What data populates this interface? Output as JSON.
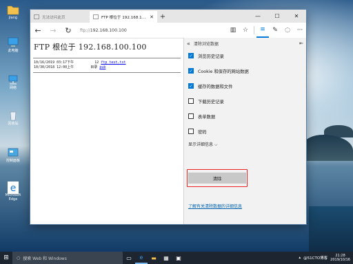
{
  "desktop": {
    "icons": [
      {
        "label": "jiang"
      },
      {
        "label": "此电脑"
      },
      {
        "label": "网络"
      },
      {
        "label": "回收站"
      },
      {
        "label": "控制面板"
      },
      {
        "label": "Microsoft Edge"
      }
    ]
  },
  "browser": {
    "tabs": [
      {
        "label": "无法访问此页"
      },
      {
        "label": "FTP 根位于 192.168.100.1"
      }
    ],
    "address": {
      "protocol": "ftp://",
      "host": "192.168.100.100"
    }
  },
  "page": {
    "title": "FTP 根位于 192.168.100.100",
    "entries": [
      {
        "date": "10/16/2019",
        "time": "03:17下午",
        "size": "12",
        "name": "ftp test.txt"
      },
      {
        "date": "10/30/2018",
        "time": "12:00上午",
        "size": "目录",
        "name": "pub"
      }
    ]
  },
  "panel": {
    "title": "清除浏览数据",
    "options": [
      {
        "label": "浏览历史记录",
        "checked": true
      },
      {
        "label": "Cookie 和保存的网站数据",
        "checked": true
      },
      {
        "label": "缓存的数据和文件",
        "checked": true
      },
      {
        "label": "下载历史记录",
        "checked": false
      },
      {
        "label": "表单数据",
        "checked": false
      },
      {
        "label": "密码",
        "checked": false
      }
    ],
    "details_label": "显示详细信息 ⌵",
    "clear_label": "清除",
    "learn_more": "了解有关清除数据的详细信息"
  },
  "taskbar": {
    "search_placeholder": "搜索 Web 和 Windows",
    "clock_time": "21:28",
    "clock_date": "2019/10/16",
    "watermark": "@51CTO博客"
  }
}
